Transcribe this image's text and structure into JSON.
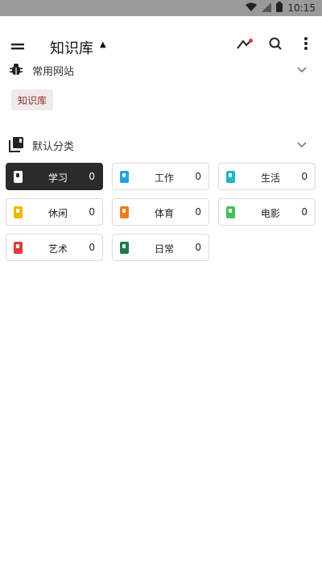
{
  "status_bar": {
    "time": "10:15"
  },
  "app_bar": {
    "title": "知识库"
  },
  "sections": {
    "favorites": {
      "title": "常用网站",
      "chip": "知识库"
    },
    "categories": {
      "title": "默认分类",
      "items": [
        {
          "label": "学习",
          "count": "0",
          "color": "#2b2b2b",
          "active": true
        },
        {
          "label": "工作",
          "count": "0",
          "color": "#29a3e0"
        },
        {
          "label": "生活",
          "count": "0",
          "color": "#1fb8c4"
        },
        {
          "label": "休闲",
          "count": "0",
          "color": "#f5b400"
        },
        {
          "label": "体育",
          "count": "0",
          "color": "#f07d16"
        },
        {
          "label": "电影",
          "count": "0",
          "color": "#43c05a"
        },
        {
          "label": "艺术",
          "count": "0",
          "color": "#e53935"
        },
        {
          "label": "日常",
          "count": "0",
          "color": "#1e7a4a"
        }
      ]
    }
  }
}
